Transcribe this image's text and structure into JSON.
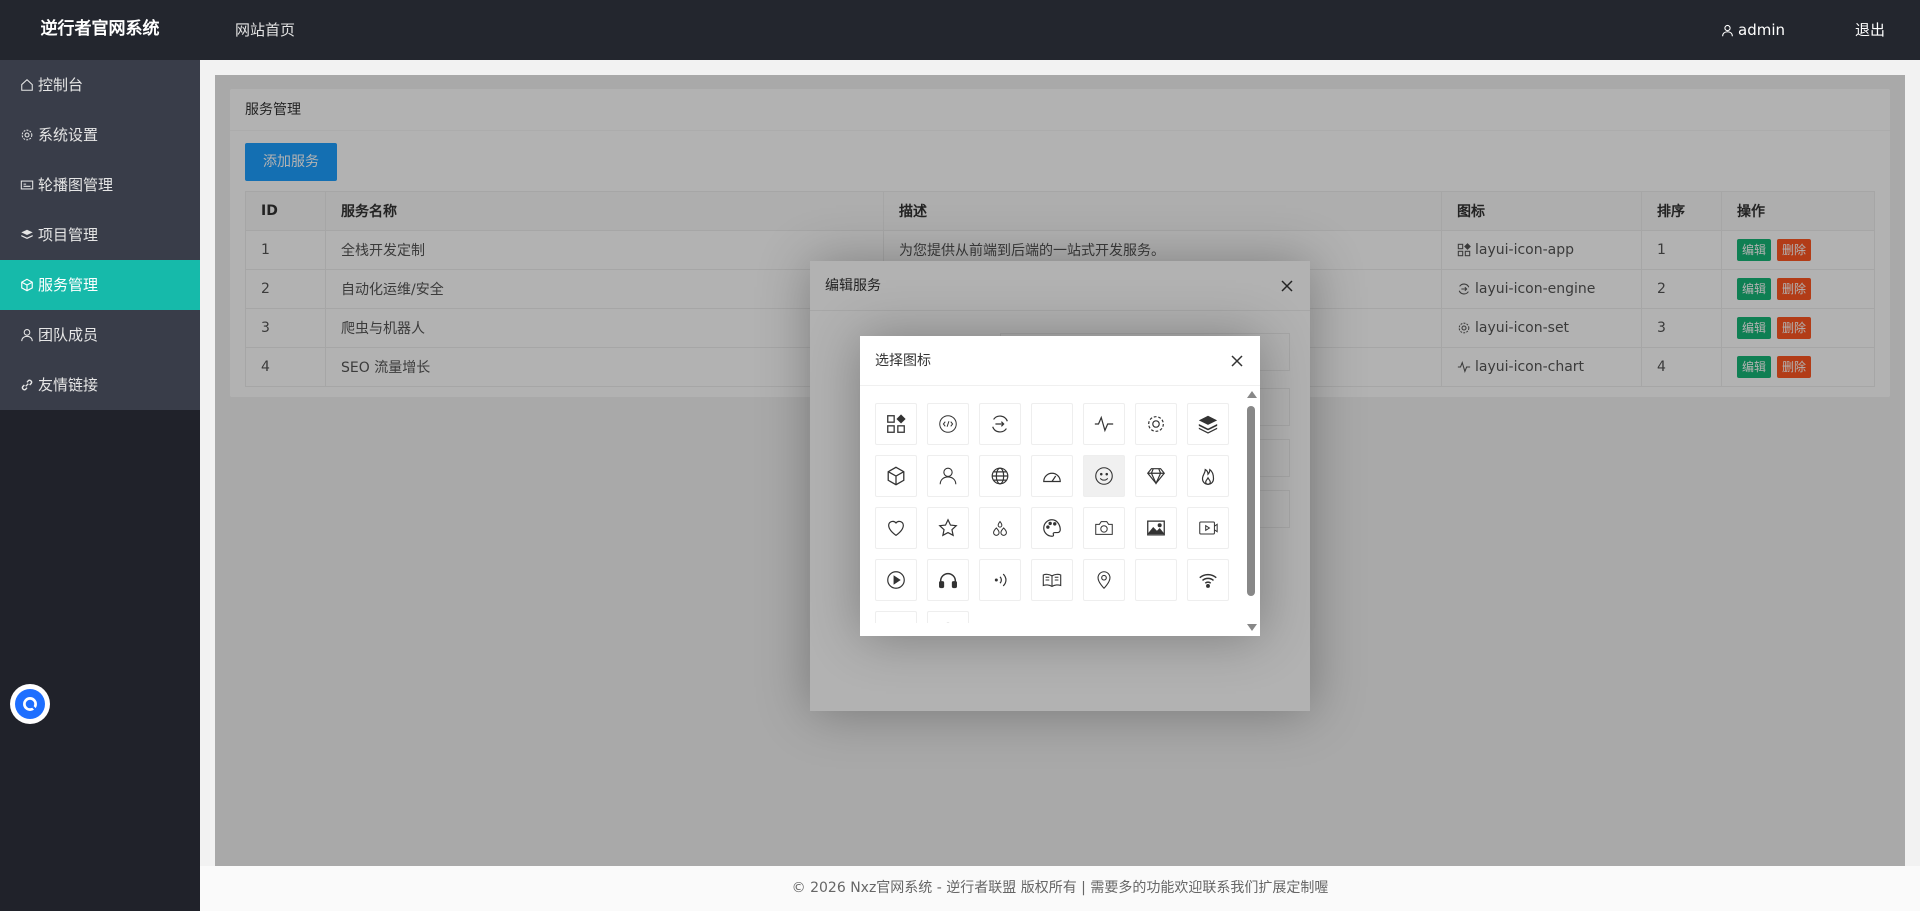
{
  "header": {
    "logo": "逆行者官网系统",
    "nav_home": "网站首页",
    "user": "admin",
    "logout": "退出"
  },
  "sidebar": {
    "items": [
      {
        "label": "控制台",
        "icon": "home-icon",
        "active": false
      },
      {
        "label": "系统设置",
        "icon": "gear-icon",
        "active": false
      },
      {
        "label": "轮播图管理",
        "icon": "slider-icon",
        "active": false
      },
      {
        "label": "项目管理",
        "icon": "layers-icon",
        "active": false
      },
      {
        "label": "服务管理",
        "icon": "cube-icon",
        "active": true
      },
      {
        "label": "团队成员",
        "icon": "user-icon",
        "active": false
      },
      {
        "label": "友情链接",
        "icon": "link-icon",
        "active": false
      }
    ]
  },
  "card": {
    "title": "服务管理",
    "add_button": "添加服务"
  },
  "table": {
    "headers": [
      "ID",
      "服务名称",
      "描述",
      "图标",
      "排序",
      "操作"
    ],
    "rows": [
      {
        "id": "1",
        "name": "全栈开发定制",
        "desc": "为您提供从前端到后端的一站式开发服务。",
        "icon": "layui-icon-app",
        "sort": "1"
      },
      {
        "id": "2",
        "name": "自动化运维/安全",
        "desc": "",
        "icon": "layui-icon-engine",
        "sort": "2"
      },
      {
        "id": "3",
        "name": "爬虫与机器人",
        "desc": "",
        "icon": "layui-icon-set",
        "sort": "3"
      },
      {
        "id": "4",
        "name": "SEO 流量增长",
        "desc": "",
        "icon": "layui-icon-chart",
        "sort": "4"
      }
    ],
    "edit_label": "编辑",
    "delete_label": "删除"
  },
  "edit_dialog": {
    "title": "编辑服务"
  },
  "icon_dialog": {
    "title": "选择图标",
    "icons": [
      "app-icon",
      "code-icon",
      "engine-icon",
      "blank-icon",
      "chart-icon",
      "set-icon",
      "layers-icon",
      "cube-icon",
      "user-icon",
      "website-icon",
      "dashboard-icon",
      "smile-icon",
      "diamond-icon",
      "fire-icon",
      "heart-icon",
      "star-icon",
      "water-icon",
      "palette-icon",
      "camera-icon",
      "picture-icon",
      "video-icon",
      "play-icon",
      "headset-icon",
      "sound-icon",
      "read-icon",
      "location-icon",
      "blank-icon",
      "wifi-icon",
      "gift-icon",
      "compass-icon"
    ]
  },
  "footer": {
    "text": "© 2026 Nxz官网系统 - 逆行者联盟 版权所有 | 需要多的功能欢迎联系我们扩展定制喔"
  },
  "colors": {
    "header_bg": "#23262e",
    "sidebar_bg": "#393d49",
    "active": "#16baaa",
    "primary_btn": "#1e9fff",
    "edit_btn": "#16b777",
    "delete_btn": "#ff5722"
  }
}
